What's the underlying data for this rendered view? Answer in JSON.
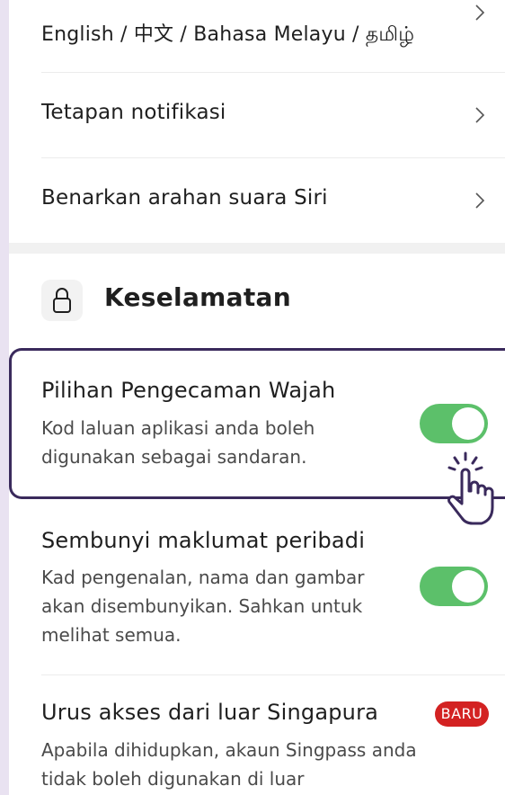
{
  "settings": {
    "language": "English / 中文 / Bahasa Melayu / தமிழ்",
    "notifications": "Tetapan notifikasi",
    "siri": "Benarkan arahan suara Siri"
  },
  "security": {
    "title": "Keselamatan",
    "face": {
      "title": "Pilihan Pengecaman Wajah",
      "desc": "Kod laluan aplikasi anda boleh digunakan sebagai sandaran.",
      "enabled": true
    },
    "hide": {
      "title": "Sembunyi maklumat peribadi",
      "desc": "Kad pengenalan, nama dan gambar akan disembunyikan. Sahkan untuk melihat semua.",
      "enabled": true
    },
    "overseas": {
      "title": "Urus akses dari luar Singapura",
      "badge": "BARU",
      "desc": "Apabila dihidupkan, akaun Singpass anda tidak boleh digunakan di luar"
    }
  },
  "colors": {
    "toggle_on": "#5cc06a",
    "badge": "#d32222",
    "highlight_border": "#3a2a5c"
  },
  "icons": [
    "chevron-right-icon",
    "lock-icon",
    "tap-hand-icon"
  ]
}
